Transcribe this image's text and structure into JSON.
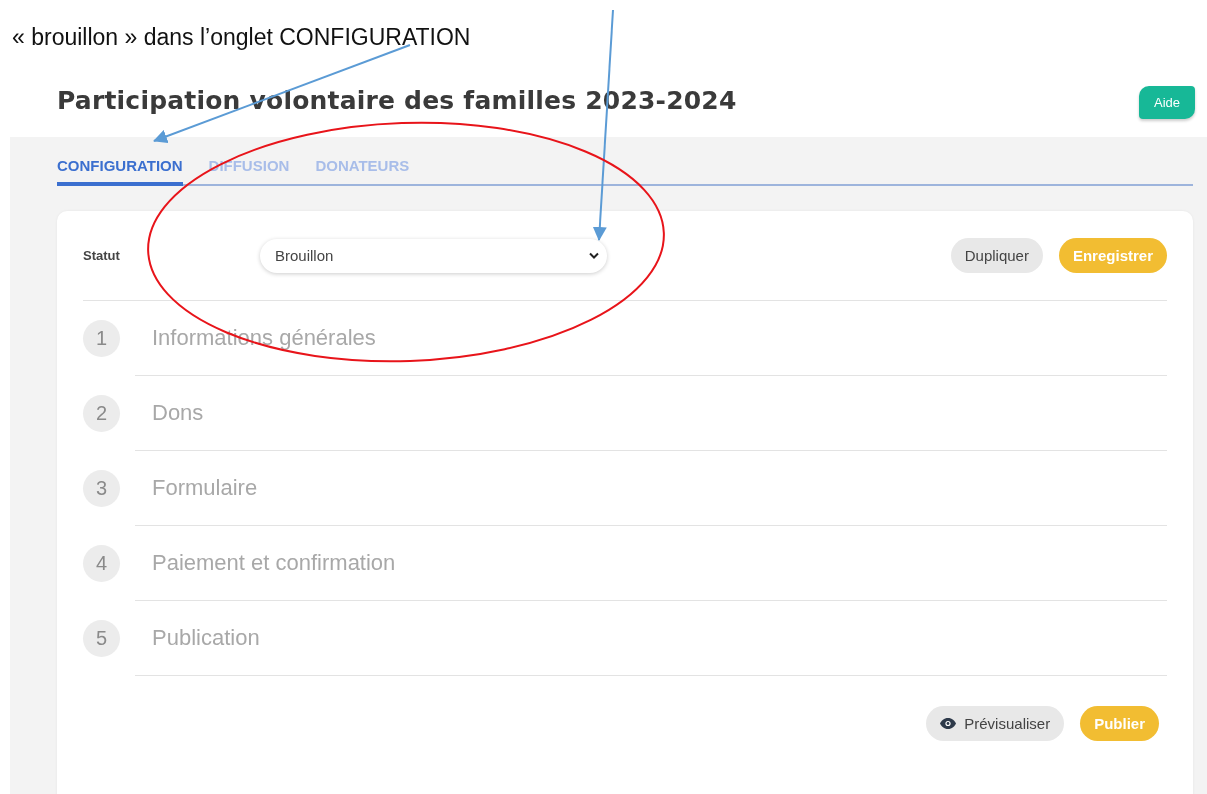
{
  "caption": "« brouillon » dans l’onglet CONFIGURATION",
  "page_title": "Participation volontaire des familles 2023-2024",
  "help_button": "Aide",
  "tabs": [
    {
      "label": "CONFIGURATION",
      "selected": true
    },
    {
      "label": "DIFFUSION",
      "selected": false
    },
    {
      "label": "DONATEURS",
      "selected": false
    }
  ],
  "status": {
    "label": "Statut",
    "value": "Brouillon"
  },
  "top_buttons": [
    {
      "label": "Dupliquer",
      "kind": "secondary"
    },
    {
      "label": "Enregistrer",
      "kind": "primary"
    }
  ],
  "steps": [
    {
      "number": "1",
      "label": "Informations générales"
    },
    {
      "number": "2",
      "label": "Dons"
    },
    {
      "number": "3",
      "label": "Formulaire"
    },
    {
      "number": "4",
      "label": "Paiement et confirmation"
    },
    {
      "number": "5",
      "label": "Publication"
    }
  ],
  "bottom_buttons": [
    {
      "label": "Prévisualiser",
      "kind": "preview"
    },
    {
      "label": "Publier",
      "kind": "primary"
    }
  ]
}
